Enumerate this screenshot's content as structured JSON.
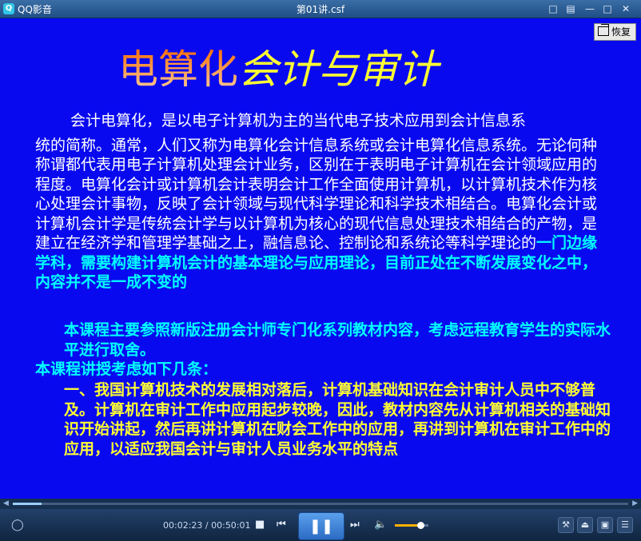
{
  "app": {
    "name": "QQ影音",
    "logo_char": "Q"
  },
  "window": {
    "title": "第01讲.csf"
  },
  "titlebar_icons": [
    "chat-icon",
    "skin-icon",
    "minimize-icon",
    "maximize-icon",
    "close-icon"
  ],
  "video": {
    "restore_label": "恢复",
    "slide": {
      "title_part1": "电算化",
      "title_part2": "会计与审计",
      "p1_line1": "会计电算化，是以电子计算机为主的当代电子技术应用到会计信息系",
      "p1_rest": "统的简称。通常，人们又称为电算化会计信息系统或会计电算化信息系统。无论何种称谓都代表用电子计算机处理会计业务，区别在于表明电子计算机在会计领域应用的程度。电算化会计或计算机会计表明会计工作全面使用计算机，以计算机技术作为核心处理会计事物，反映了会计领域与现代科学理论和科学技术相结合。电算化会计或计算机会计学是传统会计学与以计算机为核心的现代信息处理技术相结合的产物，是建立在经济学和管理学基础之上，融信息论、控制论和系统论等科学理论的",
      "p1_highlight": "一门边缘学科，需要构建计算机会计的基本理论与应用理论，目前正处在不断发展变化之中，内容并不是一成不变的",
      "p2_line": "本课程主要参照新版注册会计师专门化系列教材内容，考虑远程教育学生的实际水平进行取舍。",
      "p2_heading": "本课程讲授考虑如下几条：",
      "p3": "一、我国计算机技术的发展相对落后，计算机基础知识在会计审计人员中不够普及。计算机在审计工作中应用起步较晚，因此，教材内容先从计算机相关的基础知识开始讲起，然后再讲计算机在财会工作中的应用，再讲到计算机在审计工作中的应用，以适应我国会计与审计人员业务水平的特点"
    },
    "colors": {
      "background": "#0909f0",
      "title_gradient": "#ff6a00",
      "title_yellow": "#ffff33",
      "cyan": "#00ffff"
    }
  },
  "player": {
    "time_current": "00:02:23",
    "time_separator": " / ",
    "time_total": "00:50:01",
    "progress_fraction": 0.047,
    "volume_fraction": 0.75,
    "buttons": [
      "stop-icon",
      "prev-icon",
      "pause-icon",
      "next-icon",
      "volume-icon"
    ],
    "right_tools": [
      "tools-icon",
      "eject-icon",
      "screen-icon",
      "playlist-icon"
    ]
  }
}
